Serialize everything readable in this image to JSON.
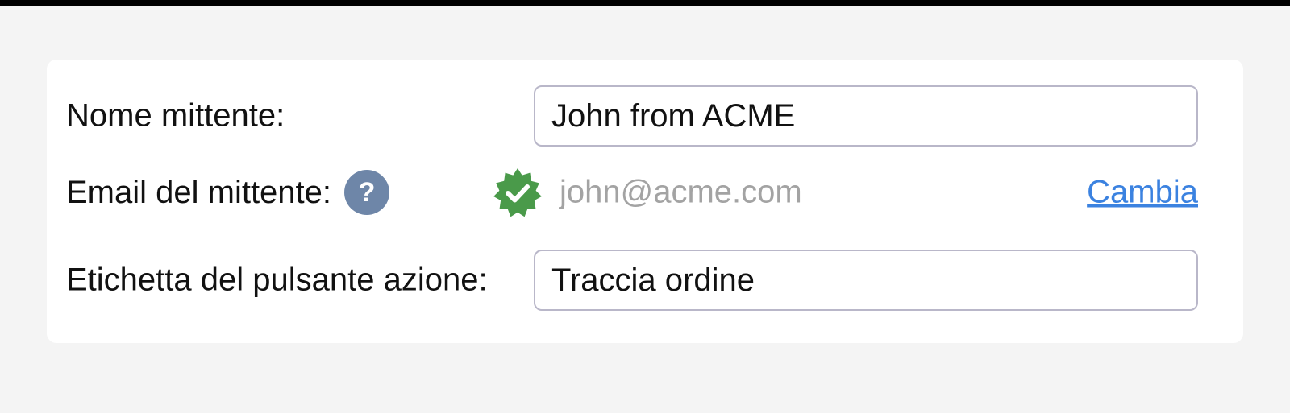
{
  "form": {
    "sender_name": {
      "label": "Nome mittente:",
      "value": "John from ACME"
    },
    "sender_email": {
      "label": "Email del mittente:",
      "help_icon": "question-mark-icon",
      "help_glyph": "?",
      "verified_icon": "verified-badge-icon",
      "value": "john@acme.com",
      "change_link": "Cambia"
    },
    "action_button_label": {
      "label": "Etichetta del pulsante azione:",
      "value": "Traccia ordine"
    }
  },
  "colors": {
    "verified_badge": "#4a9a4a",
    "help_icon": "#6e86a8",
    "link": "#3b82e0",
    "input_border": "#b9b7c9",
    "email_text": "#a3a3a3"
  }
}
